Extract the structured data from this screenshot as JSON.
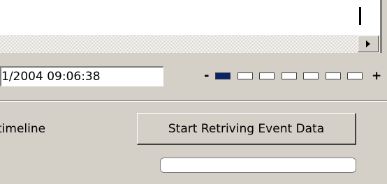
{
  "header": {
    "scroll_right_icon": "arrow-right-icon"
  },
  "time_panel": {
    "date_value": "1/2004 09:06:38",
    "zoom": {
      "minus_label": "-",
      "plus_label": "+",
      "levels": 7,
      "active_level": 1
    }
  },
  "actions": {
    "timeline_label": "timeline",
    "start_button_label": "Start Retriving Event Data",
    "progress": 0
  },
  "colors": {
    "panel_bg": "#d4d0c8",
    "accent": "#0a246a"
  }
}
